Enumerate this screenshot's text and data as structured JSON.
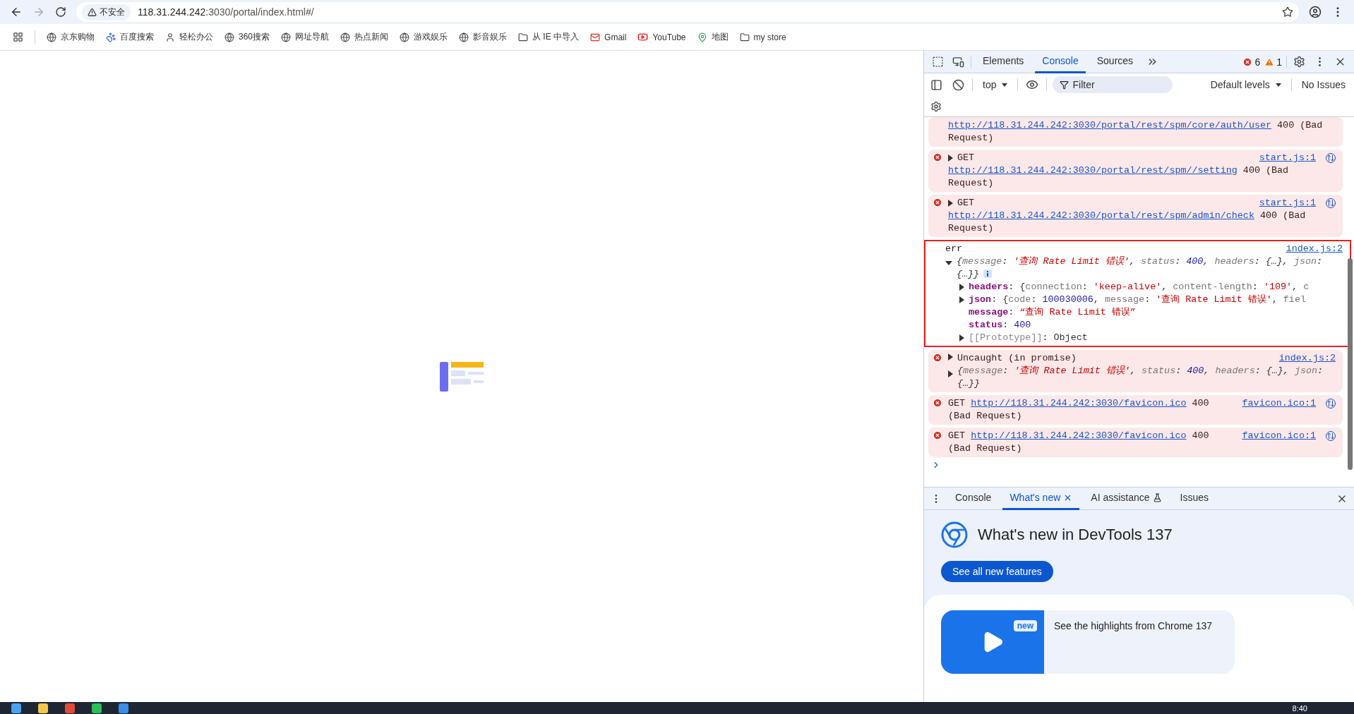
{
  "browser": {
    "security_label": "不安全",
    "url_host": "118.31.244.242",
    "url_rest": ":3030/portal/index.html#/",
    "bookmarks": [
      {
        "label": "京东购物",
        "kind": "globe"
      },
      {
        "label": "百度搜索",
        "kind": "paw"
      },
      {
        "label": "轻松办公",
        "kind": "avatar"
      },
      {
        "label": "360搜索",
        "kind": "globe"
      },
      {
        "label": "网址导航",
        "kind": "globe"
      },
      {
        "label": "热点新闻",
        "kind": "globe"
      },
      {
        "label": "游戏娱乐",
        "kind": "globe"
      },
      {
        "label": "影音娱乐",
        "kind": "globe"
      },
      {
        "label": "从 IE 中导入",
        "kind": "folder"
      },
      {
        "label": "Gmail",
        "kind": "gmail"
      },
      {
        "label": "YouTube",
        "kind": "youtube"
      },
      {
        "label": "地图",
        "kind": "map"
      },
      {
        "label": "my store",
        "kind": "folder"
      }
    ]
  },
  "devtools": {
    "tabs": [
      {
        "label": "Elements",
        "selected": false
      },
      {
        "label": "Console",
        "selected": true
      },
      {
        "label": "Sources",
        "selected": false
      }
    ],
    "error_count": "6",
    "warning_count": "1",
    "toolbar": {
      "context": "top",
      "filter_placeholder": "Filter",
      "levels": "Default levels",
      "issues": "No Issues"
    },
    "messages": [
      {
        "kind": "error",
        "icon": false,
        "expander": false,
        "url": "http://118.31.244.242:3030/portal/rest/spm/core/auth/user",
        "suffix": "400 (Bad Request)",
        "network_icon": false
      },
      {
        "kind": "error",
        "icon": true,
        "expander": true,
        "prefix": "GET",
        "url": "http://118.31.244.242:3030/portal/rest/spm//setting",
        "suffix": "400 (Bad Request)",
        "source": "start.js:1",
        "network_icon": true
      },
      {
        "kind": "error",
        "icon": true,
        "expander": true,
        "prefix": "GET",
        "url": "http://118.31.244.242:3030/portal/rest/spm/admin/check",
        "suffix": "400 (Bad Request)",
        "source": "start.js:1",
        "network_icon": true
      },
      {
        "kind": "object",
        "highlighted": true,
        "label": "err",
        "source": "index.js:2",
        "expanded": true,
        "summary": [
          {
            "kind": "punct",
            "text": "{"
          },
          {
            "kind": "key",
            "text": "message"
          },
          {
            "kind": "punct",
            "text": ": "
          },
          {
            "kind": "string",
            "text": "'查询 Rate Limit 错误'"
          },
          {
            "kind": "punct",
            "text": ", "
          },
          {
            "kind": "key",
            "text": "status"
          },
          {
            "kind": "punct",
            "text": ": "
          },
          {
            "kind": "number",
            "text": "400"
          },
          {
            "kind": "punct",
            "text": ", "
          },
          {
            "kind": "key",
            "text": "headers"
          },
          {
            "kind": "punct",
            "text": ": {…}, "
          },
          {
            "kind": "key",
            "text": "json"
          },
          {
            "kind": "punct",
            "text": ": {…}}"
          }
        ],
        "properties": [
          {
            "name": "headers",
            "expander": true,
            "own": true,
            "value": [
              {
                "kind": "punct",
                "text": ": {"
              },
              {
                "kind": "key",
                "text": "connection"
              },
              {
                "kind": "punct",
                "text": ": "
              },
              {
                "kind": "string",
                "text": "'keep-alive'"
              },
              {
                "kind": "punct",
                "text": ", "
              },
              {
                "kind": "key",
                "text": "content-length"
              },
              {
                "kind": "punct",
                "text": ": "
              },
              {
                "kind": "string",
                "text": "'109'"
              },
              {
                "kind": "punct",
                "text": ", "
              },
              {
                "kind": "key",
                "text": "c"
              }
            ]
          },
          {
            "name": "json",
            "expander": true,
            "own": true,
            "value": [
              {
                "kind": "punct",
                "text": ": {"
              },
              {
                "kind": "key",
                "text": "code"
              },
              {
                "kind": "punct",
                "text": ": "
              },
              {
                "kind": "number",
                "text": "100030006"
              },
              {
                "kind": "punct",
                "text": ", "
              },
              {
                "kind": "key",
                "text": "message"
              },
              {
                "kind": "punct",
                "text": ": "
              },
              {
                "kind": "string",
                "text": "'查询 Rate Limit 错误'"
              },
              {
                "kind": "punct",
                "text": ", "
              },
              {
                "kind": "key",
                "text": "fiel"
              }
            ]
          },
          {
            "name": "message",
            "expander": false,
            "own": true,
            "value": [
              {
                "kind": "punct",
                "text": ": "
              },
              {
                "kind": "string",
                "text": "“查询 Rate Limit 错误”"
              }
            ]
          },
          {
            "name": "status",
            "expander": false,
            "own": true,
            "value": [
              {
                "kind": "punct",
                "text": ": "
              },
              {
                "kind": "number",
                "text": "400"
              }
            ]
          },
          {
            "name": "[[Prototype]]",
            "expander": true,
            "own": false,
            "value": [
              {
                "kind": "punct",
                "text": ": Object"
              }
            ]
          }
        ]
      },
      {
        "kind": "uncaught",
        "icon": true,
        "prefix": "Uncaught (in promise)",
        "source": "index.js:2",
        "expanded": false,
        "summary": [
          {
            "kind": "punct",
            "text": "{"
          },
          {
            "kind": "key",
            "text": "message"
          },
          {
            "kind": "punct",
            "text": ": "
          },
          {
            "kind": "string",
            "text": "'查询 Rate Limit 错误'"
          },
          {
            "kind": "punct",
            "text": ", "
          },
          {
            "kind": "key",
            "text": "status"
          },
          {
            "kind": "punct",
            "text": ": "
          },
          {
            "kind": "number",
            "text": "400"
          },
          {
            "kind": "punct",
            "text": ", "
          },
          {
            "kind": "key",
            "text": "headers"
          },
          {
            "kind": "punct",
            "text": ": {…}, "
          },
          {
            "kind": "key",
            "text": "json"
          },
          {
            "kind": "punct",
            "text": ": {…}}"
          }
        ]
      },
      {
        "kind": "error",
        "icon": true,
        "expander": false,
        "prefix": "GET",
        "url": "http://118.31.244.242:3030/favicon.ico",
        "suffix": "400 (Bad Request)",
        "source": "favicon.ico:1",
        "network_icon": true
      },
      {
        "kind": "error",
        "icon": true,
        "expander": false,
        "prefix": "GET",
        "url": "http://118.31.244.242:3030/favicon.ico",
        "suffix": "400 (Bad Request)",
        "source": "favicon.ico:1",
        "network_icon": true
      }
    ],
    "drawer": {
      "tabs": [
        {
          "label": "Console",
          "selected": false,
          "closable": false,
          "experimental": false
        },
        {
          "label": "What's new",
          "selected": true,
          "closable": true,
          "experimental": false
        },
        {
          "label": "AI assistance",
          "selected": false,
          "closable": false,
          "experimental": true
        },
        {
          "label": "Issues",
          "selected": false,
          "closable": false,
          "experimental": false
        }
      ],
      "title": "What's new in DevTools 137",
      "button": "See all new features",
      "video_badge": "new",
      "video_text": "See the highlights from Chrome 137"
    }
  },
  "taskbar": {
    "clock": "8:40"
  }
}
